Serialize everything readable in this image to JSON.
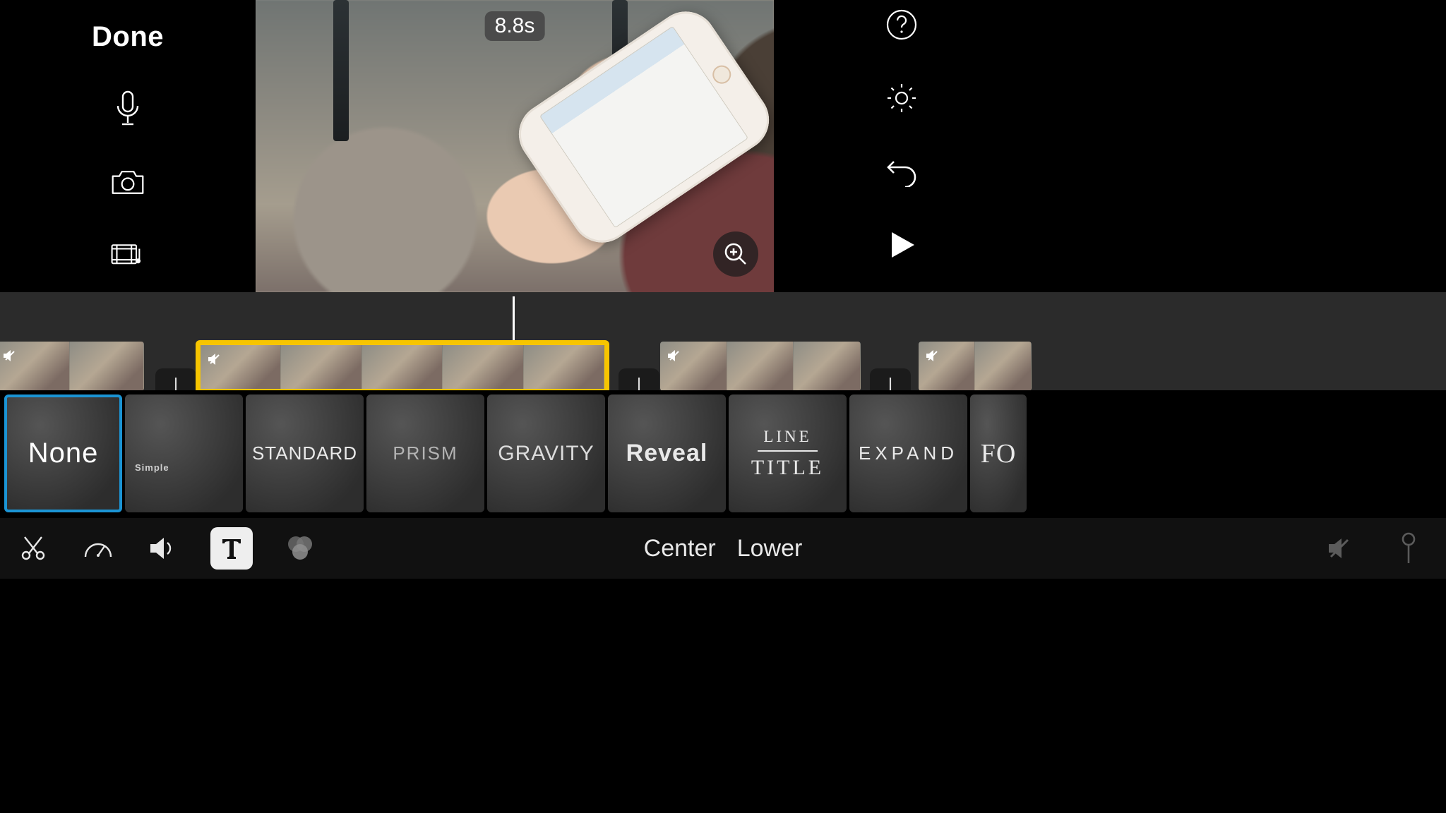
{
  "header": {
    "done_label": "Done",
    "timecode": "8.8s"
  },
  "title_styles": [
    {
      "id": "none",
      "label": "None",
      "selected": true
    },
    {
      "id": "simple",
      "label": "Simple",
      "selected": false
    },
    {
      "id": "standard",
      "label": "STANDARD",
      "selected": false
    },
    {
      "id": "prism",
      "label": "PRISM",
      "selected": false
    },
    {
      "id": "gravity",
      "label": "GRAVITY",
      "selected": false
    },
    {
      "id": "reveal",
      "label": "Reveal",
      "selected": false
    },
    {
      "id": "line",
      "label_top": "LINE",
      "label_bottom": "TITLE",
      "selected": false
    },
    {
      "id": "expand",
      "label": "EXPAND",
      "selected": false
    },
    {
      "id": "focus",
      "label": "FO",
      "selected": false
    }
  ],
  "title_position": {
    "center": "Center",
    "lower": "Lower"
  },
  "tools": {
    "active": "text"
  },
  "colors": {
    "selection_yellow": "#f7c500",
    "selection_blue": "#1b94d4"
  }
}
